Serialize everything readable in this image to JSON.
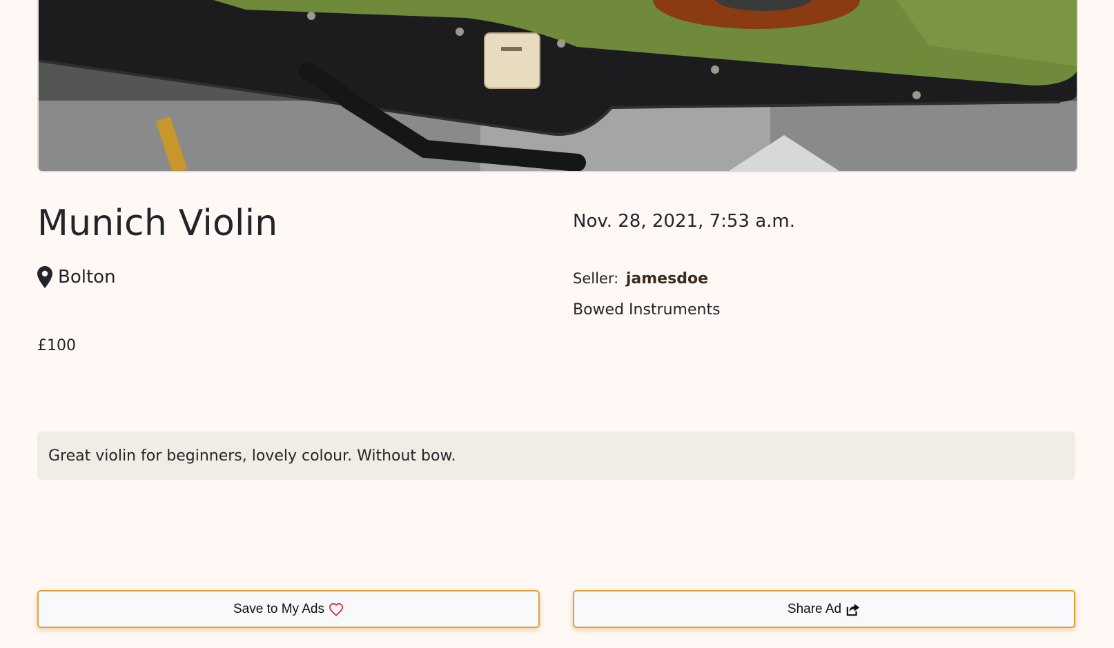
{
  "listing": {
    "title": "Munich Violin",
    "date": "Nov. 28, 2021, 7:53 a.m.",
    "location": "Bolton",
    "location_icon": "map-marker-icon",
    "seller_label": "Seller:",
    "seller_name": "jamesdoe",
    "category": "Bowed Instruments",
    "price": "£100",
    "description": "Great violin for beginners, lovely colour. Without bow."
  },
  "actions": {
    "save_label": "Save to My Ads",
    "save_icon": "heart-icon",
    "share_label": "Share Ad",
    "share_icon": "share-icon"
  },
  "colors": {
    "background": "#fff8f5",
    "description_bg": "#f1ede4",
    "button_border": "#e0a030",
    "heart": "#e0303a",
    "seller_name": "#3b2a1e"
  }
}
